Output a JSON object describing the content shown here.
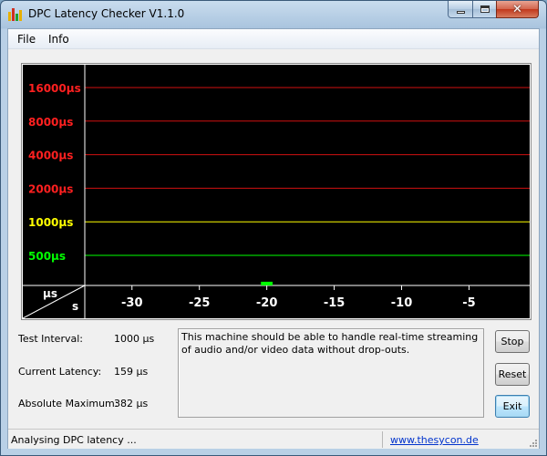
{
  "window": {
    "title": "DPC Latency Checker V1.1.0",
    "controls": {
      "minimize": "minimize-icon",
      "maximize": "maximize-icon",
      "close": "close-icon"
    }
  },
  "menu": {
    "file": "File",
    "info": "Info"
  },
  "chart_data": {
    "type": "bar",
    "scale": "log",
    "y_tick_labels": [
      {
        "text": "16000µs",
        "value": 16000,
        "color": "#ff2020"
      },
      {
        "text": "8000µs",
        "value": 8000,
        "color": "#ff2020"
      },
      {
        "text": "4000µs",
        "value": 4000,
        "color": "#ff2020"
      },
      {
        "text": "2000µs",
        "value": 2000,
        "color": "#ff2020"
      },
      {
        "text": "1000µs",
        "value": 1000,
        "color": "#ffff00"
      },
      {
        "text": "500µs",
        "value": 500,
        "color": "#00ff00"
      }
    ],
    "x_tick_labels": [
      "-30",
      "-25",
      "-20",
      "-15",
      "-10",
      "-5"
    ],
    "x_tick_values": [
      -30,
      -25,
      -20,
      -15,
      -10,
      -5
    ],
    "xlim": [
      -33,
      0
    ],
    "axis_corner": {
      "y_unit": "µs",
      "x_unit": "s"
    },
    "bar_color": "#00ff00",
    "series": [
      {
        "x": [
          -33,
          -32,
          -31,
          -30,
          -29,
          -28,
          -27,
          -26,
          -25,
          -24,
          -23,
          -22,
          -21,
          -20,
          -19,
          -18,
          -17,
          -16,
          -15,
          -14,
          -13,
          -12,
          -11,
          -10,
          -9,
          -8,
          -7,
          -6,
          -5,
          -4,
          -3,
          -2,
          -1
        ],
        "values": [
          160,
          160,
          165,
          160,
          155,
          170,
          240,
          175,
          250,
          160,
          180,
          170,
          160,
          290,
          160,
          165,
          165,
          160,
          165,
          155,
          240,
          165,
          165,
          165,
          160,
          165,
          160,
          165,
          165,
          160,
          165,
          160,
          165
        ]
      }
    ]
  },
  "stats": {
    "test_interval_label": "Test Interval:",
    "test_interval_value": "1000 µs",
    "current_latency_label": "Current Latency:",
    "current_latency_value": "159 µs",
    "absolute_maximum_label": "Absolute Maximum:",
    "absolute_maximum_value": "382 µs"
  },
  "message": "This machine should be able to handle real-time streaming of audio and/or video data without drop-outs.",
  "buttons": {
    "stop": "Stop",
    "reset": "Reset",
    "exit": "Exit"
  },
  "status": {
    "text": "Analysing DPC latency ...",
    "link": "www.thesycon.de"
  }
}
